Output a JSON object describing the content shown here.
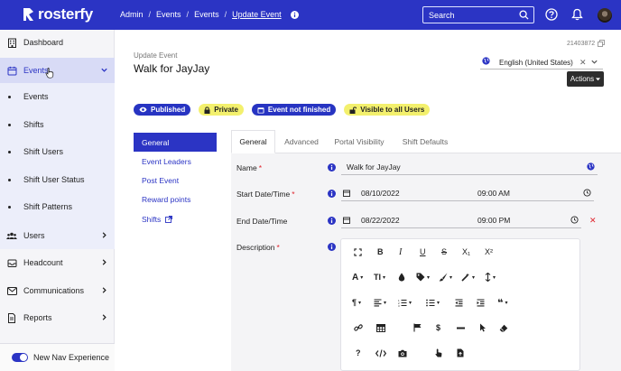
{
  "app": {
    "brand": "rosterfy",
    "breadcrumbs": [
      "Admin",
      "Events",
      "Events",
      "Update Event"
    ],
    "search_placeholder": "Search"
  },
  "sidebar": {
    "items": [
      {
        "label": "Dashboard",
        "icon": "building-icon"
      },
      {
        "label": "Events",
        "icon": "calendar-icon",
        "expanded": true
      },
      {
        "label": "Users",
        "icon": "users-icon"
      },
      {
        "label": "Headcount",
        "icon": "inbox-icon"
      },
      {
        "label": "Communications",
        "icon": "envelope-icon"
      },
      {
        "label": "Reports",
        "icon": "document-icon"
      }
    ],
    "event_subitems": [
      "Events",
      "Shifts",
      "Shift Users",
      "Shift User Status",
      "Shift Patterns"
    ],
    "footer_toggle_label": "New Nav Experience"
  },
  "page": {
    "event_id": "21403872",
    "subtitle": "Update Event",
    "title": "Walk for JayJay",
    "language": "English (United States)",
    "actions_label": "Actions",
    "badges": [
      {
        "label": "Published",
        "icon": "eye-icon",
        "style": "blue"
      },
      {
        "label": "Private",
        "icon": "lock-icon",
        "style": "yellow"
      },
      {
        "label": "Event not finished",
        "icon": "calendar-icon",
        "style": "blue"
      },
      {
        "label": "Visible to all Users",
        "icon": "unlock-icon",
        "style": "yellow"
      }
    ],
    "subnav": [
      "General",
      "Event Leaders",
      "Post Event",
      "Reward points",
      "Shifts"
    ],
    "tabs": [
      "General",
      "Advanced",
      "Portal Visibility",
      "Shift Defaults"
    ],
    "fields": {
      "name_label": "Name",
      "name_value": "Walk for JayJay",
      "start_label": "Start Date/Time",
      "start_date": "08/10/2022",
      "start_time": "09:00  AM",
      "end_label": "End Date/Time",
      "end_date": "08/22/2022",
      "end_time": "09:00  PM",
      "description_label": "Description"
    },
    "editor_toolbar": {
      "row1": [
        "fullscreen",
        "bold",
        "italic",
        "underline",
        "strikethrough",
        "subscript",
        "superscript"
      ],
      "subscript": "X₁",
      "superscript": "X²",
      "font_size": "TI"
    }
  },
  "colors": {
    "brand": "#2b34c4",
    "badge_yellow": "#f3f06d",
    "required": "#e0242d"
  }
}
